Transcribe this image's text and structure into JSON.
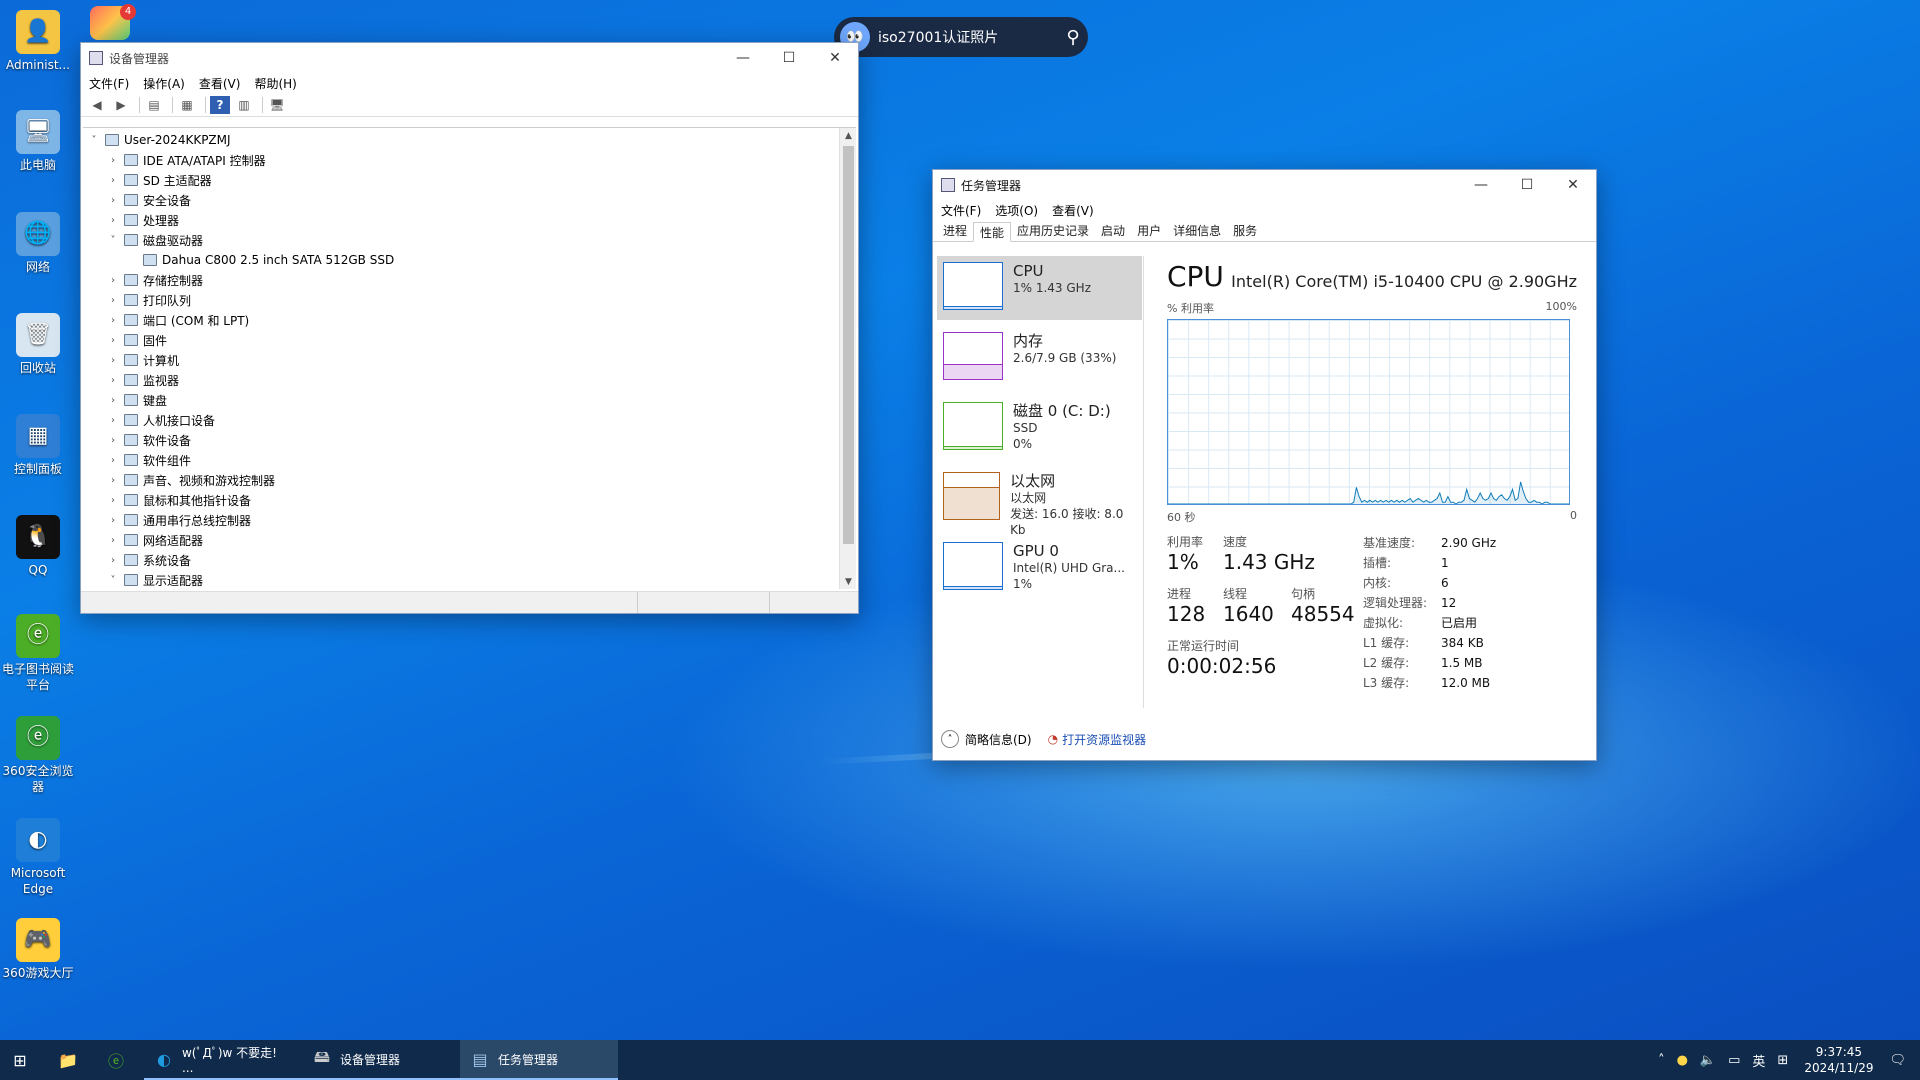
{
  "desktop": {
    "icons": [
      {
        "label": "Administ...",
        "icon": "user-folder-icon"
      },
      {
        "label": "此电脑",
        "icon": "computer-icon"
      },
      {
        "label": "网络",
        "icon": "network-icon"
      },
      {
        "label": "回收站",
        "icon": "recycle-bin-icon"
      },
      {
        "label": "控制面板",
        "icon": "control-panel-icon"
      },
      {
        "label": "QQ",
        "icon": "qq-icon"
      },
      {
        "label": "电子图书阅读平台",
        "icon": "ebook-icon"
      },
      {
        "label": "360安全浏览器",
        "icon": "360-browser-icon"
      },
      {
        "label": "Microsoft Edge",
        "icon": "edge-icon"
      },
      {
        "label": "360游戏大厅",
        "icon": "360-game-icon"
      }
    ],
    "top_app_badge": "4"
  },
  "search": {
    "text": "iso27001认证照片"
  },
  "device_manager": {
    "title": "设备管理器",
    "menu": [
      "文件(F)",
      "操作(A)",
      "查看(V)",
      "帮助(H)"
    ],
    "root": "User-2024KKPZMJ",
    "nodes": [
      {
        "label": "IDE ATA/ATAPI 控制器",
        "expanded": false,
        "indent": 1
      },
      {
        "label": "SD 主适配器",
        "expanded": false,
        "indent": 1
      },
      {
        "label": "安全设备",
        "expanded": false,
        "indent": 1
      },
      {
        "label": "处理器",
        "expanded": false,
        "indent": 1
      },
      {
        "label": "磁盘驱动器",
        "expanded": true,
        "indent": 1
      },
      {
        "label": "Dahua C800 2.5 inch SATA 512GB SSD",
        "expanded": null,
        "indent": 2
      },
      {
        "label": "存储控制器",
        "expanded": false,
        "indent": 1
      },
      {
        "label": "打印队列",
        "expanded": false,
        "indent": 1
      },
      {
        "label": "端口 (COM 和 LPT)",
        "expanded": false,
        "indent": 1
      },
      {
        "label": "固件",
        "expanded": false,
        "indent": 1
      },
      {
        "label": "计算机",
        "expanded": false,
        "indent": 1
      },
      {
        "label": "监视器",
        "expanded": false,
        "indent": 1
      },
      {
        "label": "键盘",
        "expanded": false,
        "indent": 1
      },
      {
        "label": "人机接口设备",
        "expanded": false,
        "indent": 1
      },
      {
        "label": "软件设备",
        "expanded": false,
        "indent": 1
      },
      {
        "label": "软件组件",
        "expanded": false,
        "indent": 1
      },
      {
        "label": "声音、视频和游戏控制器",
        "expanded": false,
        "indent": 1
      },
      {
        "label": "鼠标和其他指针设备",
        "expanded": false,
        "indent": 1
      },
      {
        "label": "通用串行总线控制器",
        "expanded": false,
        "indent": 1
      },
      {
        "label": "网络适配器",
        "expanded": false,
        "indent": 1
      },
      {
        "label": "系统设备",
        "expanded": false,
        "indent": 1
      },
      {
        "label": "显示适配器",
        "expanded": true,
        "indent": 1
      }
    ]
  },
  "task_manager": {
    "title": "任务管理器",
    "menu": [
      "文件(F)",
      "选项(O)",
      "查看(V)"
    ],
    "tabs": [
      "进程",
      "性能",
      "应用历史记录",
      "启动",
      "用户",
      "详细信息",
      "服务"
    ],
    "active_tab": "性能",
    "resources": [
      {
        "name": "CPU",
        "sub1": "1% 1.43 GHz",
        "sub2": "",
        "sub3": "",
        "color": "#1a6fcf",
        "selected": true
      },
      {
        "name": "内存",
        "sub1": "2.6/7.9 GB (33%)",
        "sub2": "",
        "sub3": "",
        "color": "#9b33c7",
        "selected": false
      },
      {
        "name": "磁盘 0 (C: D:)",
        "sub1": "SSD",
        "sub2": "0%",
        "sub3": "",
        "color": "#4cae26",
        "selected": false
      },
      {
        "name": "以太网",
        "sub1": "以太网",
        "sub2": "发送: 16.0 接收: 8.0 Kb",
        "sub3": "",
        "color": "#b3621b",
        "selected": false
      },
      {
        "name": "GPU 0",
        "sub1": "Intel(R) UHD Gra...",
        "sub2": "1%",
        "sub3": "",
        "color": "#1a6fcf",
        "selected": false
      }
    ],
    "cpu": {
      "heading": "CPU",
      "model": "Intel(R) Core(TM) i5-10400 CPU @ 2.90GHz",
      "graph_ylabel": "% 利用率",
      "graph_ymax": "100%",
      "graph_xleft": "60 秒",
      "graph_xright": "0",
      "utilization_label": "利用率",
      "utilization": "1%",
      "speed_label": "速度",
      "speed": "1.43 GHz",
      "processes_label": "进程",
      "processes": "128",
      "threads_label": "线程",
      "threads": "1640",
      "handles_label": "句柄",
      "handles": "48554",
      "uptime_label": "正常运行时间",
      "uptime": "0:00:02:56",
      "specs": [
        {
          "k": "基准速度:",
          "v": "2.90 GHz"
        },
        {
          "k": "插槽:",
          "v": "1"
        },
        {
          "k": "内核:",
          "v": "6"
        },
        {
          "k": "逻辑处理器:",
          "v": "12"
        },
        {
          "k": "虚拟化:",
          "v": "已启用"
        },
        {
          "k": "L1 缓存:",
          "v": "384 KB"
        },
        {
          "k": "L2 缓存:",
          "v": "1.5 MB"
        },
        {
          "k": "L3 缓存:",
          "v": "12.0 MB"
        }
      ],
      "history": [
        0,
        0,
        0,
        0,
        0,
        0,
        0,
        0,
        0,
        0,
        0,
        0,
        0,
        0,
        0,
        0,
        0,
        0,
        0,
        0,
        0,
        0,
        0,
        0,
        0,
        0,
        0,
        0,
        0,
        0,
        0,
        0,
        0,
        0,
        0,
        0,
        0,
        0,
        0,
        0,
        0,
        0,
        0,
        0,
        0,
        0,
        0,
        0,
        0,
        0,
        0,
        0,
        0,
        0,
        0,
        0,
        0,
        0,
        0,
        0,
        0,
        0,
        0,
        0,
        0,
        0,
        0,
        0,
        0,
        1,
        9,
        4,
        1,
        2,
        1,
        2,
        1,
        2,
        1,
        2,
        1,
        2,
        1,
        2,
        1,
        2,
        1,
        2,
        1,
        2,
        3,
        1,
        2,
        3,
        2,
        1,
        2,
        1,
        1,
        2,
        3,
        6,
        1,
        1,
        4,
        1,
        1,
        0,
        1,
        1,
        2,
        8,
        3,
        2,
        1,
        3,
        6,
        3,
        2,
        3,
        6,
        3,
        2,
        4,
        5,
        3,
        2,
        4,
        8,
        2,
        3,
        12,
        7,
        3,
        1,
        1,
        2,
        1,
        1,
        0,
        1,
        1,
        0,
        0,
        0,
        0,
        0,
        0,
        0,
        0
      ]
    },
    "footer_fewer": "简略信息(D)",
    "footer_resmon": "打开资源监视器"
  },
  "taskbar": {
    "items": [
      {
        "label": "",
        "icon": "start-icon"
      },
      {
        "label": "",
        "icon": "file-explorer-icon"
      },
      {
        "label": "",
        "icon": "360-browser-icon"
      },
      {
        "label": "w(ﾟДﾟ)w 不要走! ...",
        "icon": "edge-icon"
      },
      {
        "label": "设备管理器",
        "icon": "device-manager-icon"
      },
      {
        "label": "任务管理器",
        "icon": "task-manager-icon"
      }
    ],
    "tray_ime": "英",
    "time": "9:37:45",
    "date": "2024/11/29"
  }
}
